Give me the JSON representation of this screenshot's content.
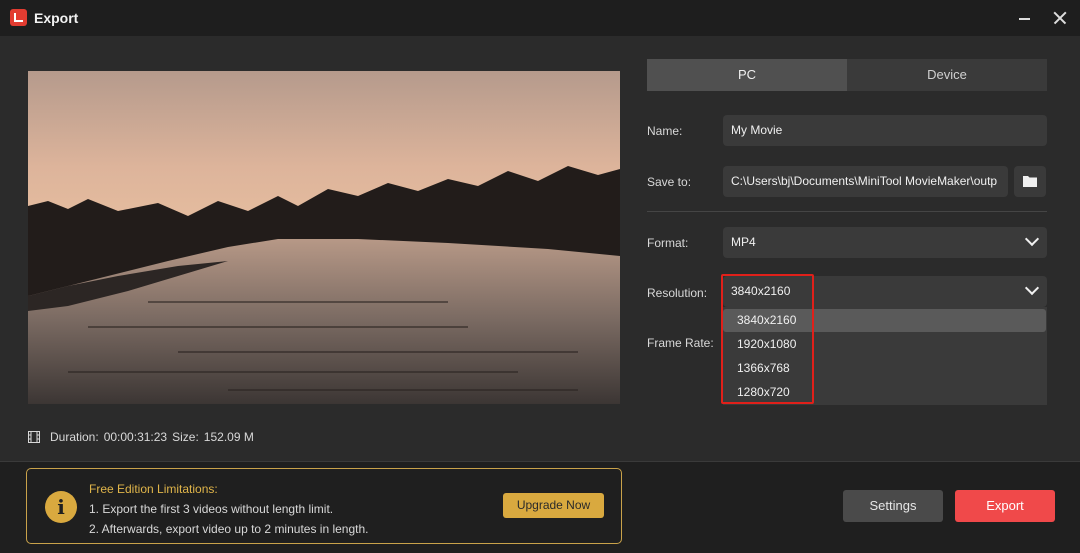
{
  "window": {
    "title": "Export"
  },
  "preview": {
    "duration_label": "Duration:",
    "duration_value": "00:00:31:23",
    "size_label": "Size:",
    "size_value": "152.09 M"
  },
  "tabs": [
    {
      "label": "PC",
      "active": true
    },
    {
      "label": "Device",
      "active": false
    }
  ],
  "form": {
    "name_label": "Name:",
    "name_value": "My Movie",
    "save_label": "Save to:",
    "save_value": "C:\\Users\\bj\\Documents\\MiniTool MovieMaker\\outp",
    "format_label": "Format:",
    "format_value": "MP4",
    "resolution_label": "Resolution:",
    "resolution_value": "3840x2160",
    "frame_rate_label": "Frame Rate:",
    "resolution_options": [
      "3840x2160",
      "1920x1080",
      "1366x768",
      "1280x720"
    ]
  },
  "limitations": {
    "title": "Free Edition Limitations:",
    "line1": "1. Export the first 3 videos without length limit.",
    "line2": "2. Afterwards, export video up to 2 minutes in length.",
    "upgrade_label": "Upgrade Now"
  },
  "actions": {
    "settings_label": "Settings",
    "export_label": "Export"
  },
  "colors": {
    "accent": "#f0494a",
    "gold": "#d9a93f",
    "highlight": "#e0201a"
  }
}
